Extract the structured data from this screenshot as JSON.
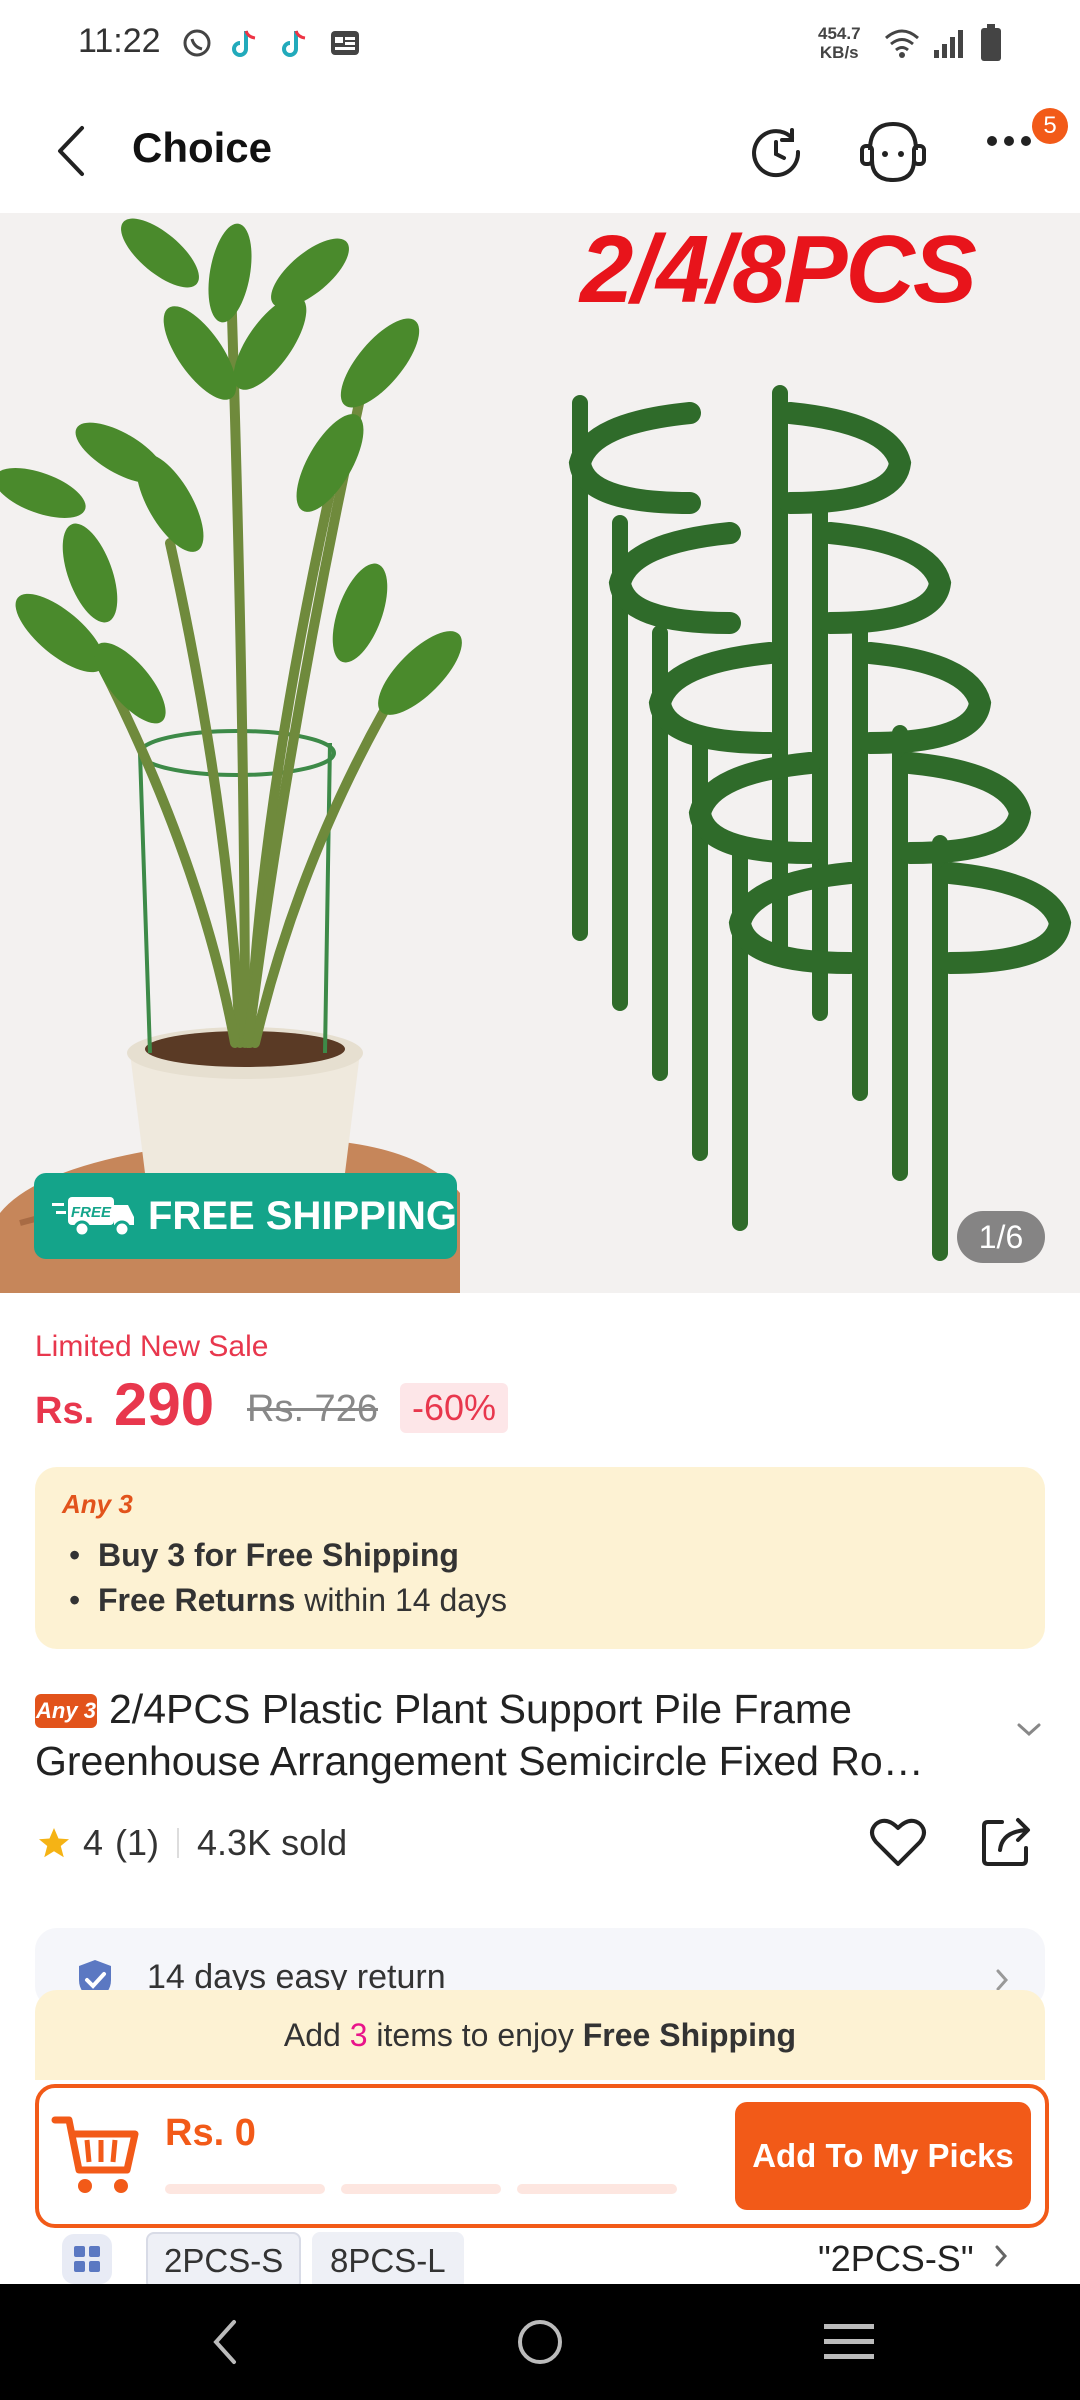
{
  "status_bar": {
    "time": "11:22",
    "net_speed_value": "454.7",
    "net_speed_unit": "KB/s"
  },
  "header": {
    "title": "Choice",
    "notification_count": "5"
  },
  "hero": {
    "promo_text": "2/4/8PCS",
    "free_shipping_label": "FREE SHIPPING",
    "free_tag": "FREE",
    "image_counter": "1/6"
  },
  "price": {
    "sale_label": "Limited New Sale",
    "currency": "Rs.",
    "value": "290",
    "original": "Rs. 726",
    "discount": "-60%"
  },
  "offer": {
    "tag": "Any 3",
    "line1_bold": "Buy 3 for  Free Shipping",
    "line2_bold": "Free Returns",
    "line2_rest": " within 14 days"
  },
  "product": {
    "tag": "Any 3",
    "title": "2/4PCS Plastic Plant Support Pile Frame Greenhouse Arrangement Semicircle Fixed Ro…",
    "rating": "4",
    "rating_count": "(1)",
    "sold": "4.3K sold"
  },
  "returns": {
    "label": "14 days easy return"
  },
  "add_bar": {
    "prefix": "Add ",
    "count": "3",
    "middle": " items to enjoy ",
    "highlight": "Free Shipping",
    "cart_total": "Rs. 0",
    "button_label": "Add To My Picks"
  },
  "variants": {
    "options": [
      "2PCS-S",
      "8PCS-L"
    ],
    "selected": "\"2PCS-S\""
  },
  "colors": {
    "accent": "#f25a18",
    "sale_red": "#e8374d",
    "free_ship_green": "#14a48a",
    "offer_bg": "#fdf2d3"
  }
}
